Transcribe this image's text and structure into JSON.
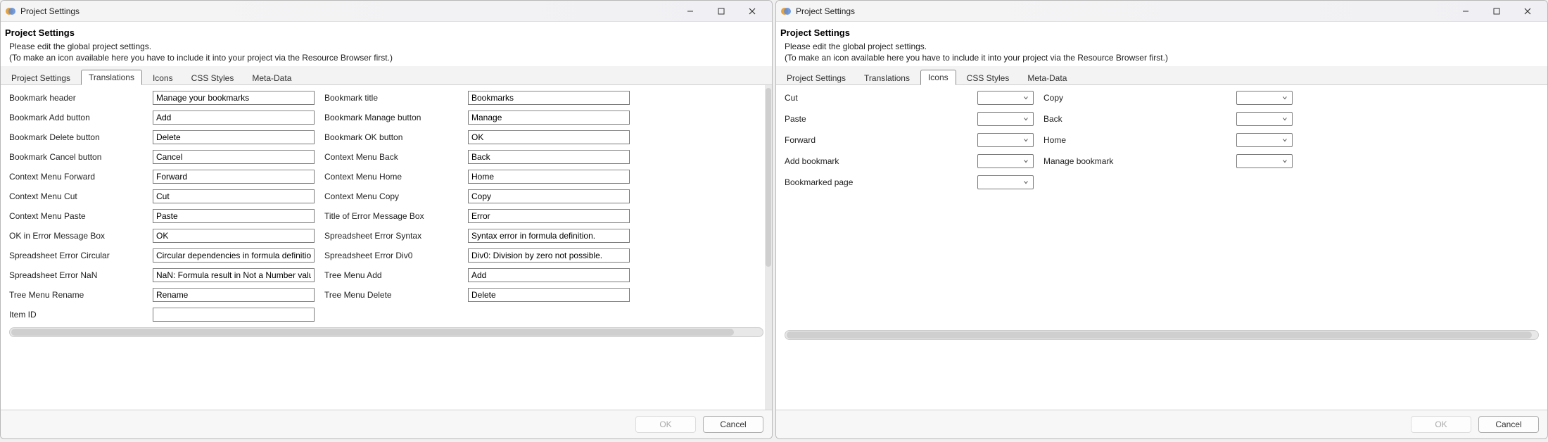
{
  "shared": {
    "window_title": "Project Settings",
    "page_title": "Project Settings",
    "subtext_line1": "Please edit the global project settings.",
    "subtext_line2": "(To make an icon available here you have to include it into your project via the Resource Browser first.)",
    "tabs": {
      "project_settings": "Project Settings",
      "translations": "Translations",
      "icons": "Icons",
      "css_styles": "CSS Styles",
      "meta_data": "Meta-Data"
    },
    "buttons": {
      "ok": "OK",
      "cancel": "Cancel"
    }
  },
  "left": {
    "active_tab": "Translations",
    "fields": [
      {
        "label": "Bookmark header",
        "value": "Manage your bookmarks"
      },
      {
        "label": "Bookmark title",
        "value": "Bookmarks"
      },
      {
        "label": "Bookmark Add button",
        "value": "Add"
      },
      {
        "label": "Bookmark Manage button",
        "value": "Manage"
      },
      {
        "label": "Bookmark Delete button",
        "value": "Delete"
      },
      {
        "label": "Bookmark OK button",
        "value": "OK"
      },
      {
        "label": "Bookmark Cancel button",
        "value": "Cancel"
      },
      {
        "label": "Context Menu Back",
        "value": "Back"
      },
      {
        "label": "Context Menu Forward",
        "value": "Forward"
      },
      {
        "label": "Context Menu Home",
        "value": "Home"
      },
      {
        "label": "Context Menu Cut",
        "value": "Cut"
      },
      {
        "label": "Context Menu Copy",
        "value": "Copy"
      },
      {
        "label": "Context Menu Paste",
        "value": "Paste"
      },
      {
        "label": "Title of Error Message Box",
        "value": "Error"
      },
      {
        "label": "OK in Error Message Box",
        "value": "OK"
      },
      {
        "label": "Spreadsheet Error Syntax",
        "value": "Syntax error in formula definition."
      },
      {
        "label": "Spreadsheet Error Circular",
        "value": "Circular dependencies in formula definition."
      },
      {
        "label": "Spreadsheet Error Div0",
        "value": "Div0: Division by zero not possible."
      },
      {
        "label": "Spreadsheet Error NaN",
        "value": "NaN: Formula result in Not a Number value."
      },
      {
        "label": "Tree Menu Add",
        "value": "Add"
      },
      {
        "label": "Tree Menu Rename",
        "value": "Rename"
      },
      {
        "label": "Tree Menu Delete",
        "value": "Delete"
      },
      {
        "label": "Item ID",
        "value": ""
      }
    ]
  },
  "right": {
    "active_tab": "Icons",
    "rows": [
      {
        "left": "Cut",
        "right": "Copy"
      },
      {
        "left": "Paste",
        "right": "Back"
      },
      {
        "left": "Forward",
        "right": "Home"
      },
      {
        "left": "Add bookmark",
        "right": "Manage bookmark"
      },
      {
        "left": "Bookmarked page",
        "right": null
      }
    ]
  }
}
